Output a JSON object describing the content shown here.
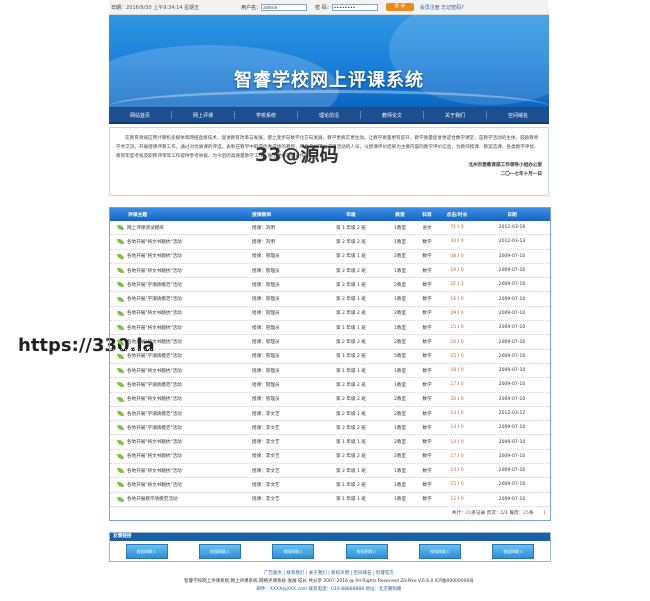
{
  "topbar": {
    "date_label": "日期：",
    "date_value": "2016/9/30 上午9:34:14 星期五",
    "user_label": "用户名：",
    "user_value": "admin",
    "pass_label": "密 码：",
    "pass_value": "••••••••",
    "login_button": "登 录",
    "links": "会员注册 忘记密码?"
  },
  "banner": {
    "title": "智睿学校网上评课系统"
  },
  "nav": [
    "网站首页",
    "网上评课",
    "学校系统",
    "理论前沿",
    "教师论文",
    "关于我们",
    "空间域名"
  ],
  "intro": {
    "para": "在教育领域应用计算机多媒体和网络直接技术，促进教育改革与发展，使之逐步向数字化方向发展，教学更真实更生动。让教学质量更有提升，教学质量促进更适合数学课堂，是教学活动的主体。鼓励教师学术交流，开展授课评教工作，通过对优质课的评选，表彰在教学中取得优秀成绩的教师，积极参加网上评课活动的人员，以授课评价结果为主要内容的教学评价信息，为教师授课、教案选课、各类教学评优、教师年度考核及职称评审等工作提供参考依据，为今后的高质量教学工作，做出更好的促进作用。",
    "sign1": "北州市委教育部工作领导小组办公室",
    "sign2": "二〇一七年十月一日"
  },
  "watermark_center": "33@源码",
  "table": {
    "headers": [
      "评课主题",
      "授课教师",
      "年级",
      "教室",
      "科目",
      "点击/时长",
      "日期"
    ],
    "rows": [
      {
        "topic": "网上评课测试模块",
        "teacher": "授课：刘明",
        "grade": "第 1 年级 2 班",
        "room": "1教室",
        "subject": "语文",
        "hits": "71",
        "mins": "3",
        "date": "2012-03-16"
      },
      {
        "topic": "各地开展\"将文书翻抗\"活动",
        "teacher": "授课：刘明",
        "grade": "第 2 年级 2 班",
        "room": "1教室",
        "subject": "数学",
        "hits": "33",
        "mins": "0",
        "date": "2012-03-13"
      },
      {
        "topic": "各地开展\"将文书翻抗\"活动",
        "teacher": "授课：管理员",
        "grade": "第 2 年级 1 班",
        "room": "2教室",
        "subject": "数学",
        "hits": "38",
        "mins": "0",
        "date": "2009-07-10"
      },
      {
        "topic": "各地开展\"将文书翻抗\"活动",
        "teacher": "授课：管理员",
        "grade": "第 2 年级 2 班",
        "room": "1教室",
        "subject": "数学",
        "hits": "19",
        "mins": "0",
        "date": "2009-07-10"
      },
      {
        "topic": "各地开展\"学潮请模范\"活动",
        "teacher": "授课：管理员",
        "grade": "第 2 年级 1 班",
        "room": "2教室",
        "subject": "数学",
        "hits": "21",
        "mins": "1",
        "date": "2009-07-10"
      },
      {
        "topic": "各地开展\"学潮请模范\"活动",
        "teacher": "授课：管理员",
        "grade": "第 2 年级 1 班",
        "room": "1教室",
        "subject": "数学",
        "hits": "16",
        "mins": "0",
        "date": "2009-07-10"
      },
      {
        "topic": "各地开展\"将文书翻抗\"活动",
        "teacher": "授课：管理员",
        "grade": "第 2 年级 2 班",
        "room": "2教室",
        "subject": "数学",
        "hits": "29",
        "mins": "0",
        "date": "2009-07-10"
      },
      {
        "topic": "各地开展\"将文书翻抗\"活动",
        "teacher": "授课：管理员",
        "grade": "第 1 年级 1 班",
        "room": "1教室",
        "subject": "数学",
        "hits": "15",
        "mins": "0",
        "date": "2009-07-10"
      },
      {
        "topic": "各地开展\"将文书翻抗\"活动",
        "teacher": "授课：管理员",
        "grade": "第 2 年级 2 班",
        "room": "2教室",
        "subject": "数学",
        "hits": "16",
        "mins": "0",
        "date": "2009-07-10"
      },
      {
        "topic": "各地开展\"学潮请模范\"活动",
        "teacher": "授课：管理员",
        "grade": "第 1 年级 2 班",
        "room": "5教室",
        "subject": "数学",
        "hits": "15",
        "mins": "0",
        "date": "2009-07-10"
      },
      {
        "topic": "各地开展\"将文书翻抗\"活动",
        "teacher": "授课：管理员",
        "grade": "第 1 年级 1 班",
        "room": "1教室",
        "subject": "数学",
        "hits": "18",
        "mins": "0",
        "date": "2009-07-10"
      },
      {
        "topic": "各地开展\"学潮请模范\"活动",
        "teacher": "授课：管理员",
        "grade": "第 2 年级 2 班",
        "room": "1教室",
        "subject": "数学",
        "hits": "17",
        "mins": "0",
        "date": "2009-07-10"
      },
      {
        "topic": "各地开展\"将文书翻抗\"活动",
        "teacher": "授课：管理员",
        "grade": "第 2 年级 2 班",
        "room": "2教室",
        "subject": "数学",
        "hits": "20",
        "mins": "0",
        "date": "2009-07-10"
      },
      {
        "topic": "各地开展\"学潮请模范\"活动",
        "teacher": "授课：李文艺",
        "grade": "第 2 年级 1 班",
        "room": "2教室",
        "subject": "数学",
        "hits": "13",
        "mins": "0",
        "date": "2012-03-12"
      },
      {
        "topic": "各地开展\"学潮请模范\"活动",
        "teacher": "授课：李文艺",
        "grade": "第 2 年级 2 班",
        "room": "1教室",
        "subject": "数学",
        "hits": "14",
        "mins": "0",
        "date": "2009-07-10"
      },
      {
        "topic": "各地开展\"将文书翻抗\"活动",
        "teacher": "授课：李文艺",
        "grade": "第 1 年级 1 班",
        "room": "2教室",
        "subject": "数学",
        "hits": "14",
        "mins": "0",
        "date": "2009-07-10"
      },
      {
        "topic": "各地开展\"将文书翻抗\"活动",
        "teacher": "授课：李文艺",
        "grade": "第 2 年级 2 班",
        "room": "2教室",
        "subject": "数学",
        "hits": "17",
        "mins": "0",
        "date": "2009-07-10"
      },
      {
        "topic": "各地开展\"将文书翻抗\"活动",
        "teacher": "授课：李文艺",
        "grade": "第 2 年级 1 班",
        "room": "1教室",
        "subject": "数学",
        "hits": "14",
        "mins": "0",
        "date": "2009-07-10"
      },
      {
        "topic": "各地开展\"将文书翻抗\"活动",
        "teacher": "授课：李文艺",
        "grade": "第 1 年级 2 班",
        "room": "1教室",
        "subject": "数学",
        "hits": "15",
        "mins": "0",
        "date": "2009-07-10"
      },
      {
        "topic": "各地开展教学请模范活动",
        "teacher": "授课：李文艺",
        "grade": "第 1 年级 1 班",
        "room": "1教室",
        "subject": "数学",
        "hits": "12",
        "mins": "0",
        "date": "2009-07-10"
      }
    ],
    "pager": {
      "prefix": "共计：",
      "total": "20",
      "mid1": "条记录 页次：",
      "page": "1/1",
      "mid2": " 每页：",
      "per": "25",
      "suffix": "条",
      "link": "1"
    }
  },
  "links": {
    "head": "友情链接",
    "logos": [
      "校园网联入",
      "校园网联入",
      "校园网联入",
      "校园网联入",
      "校园网联入",
      "校园网联入"
    ]
  },
  "footer": {
    "line1": "广告服务 | 联系我们 | 关于我们 | 新权声明 | 空间域名 | 智睿官方",
    "line2": "智睿学校网上评课系统,网上评课系统,网络评课系统-发展 成长 共分享 2007-2016 @ All Rights Reserved ZhiPike V.6.6.0 ICP备00000000号",
    "line3": "邮件：XXXX@XXX.com 联系电话：010-88888888  地址：北京朝阳路"
  },
  "side_watermark": "https://330.la"
}
